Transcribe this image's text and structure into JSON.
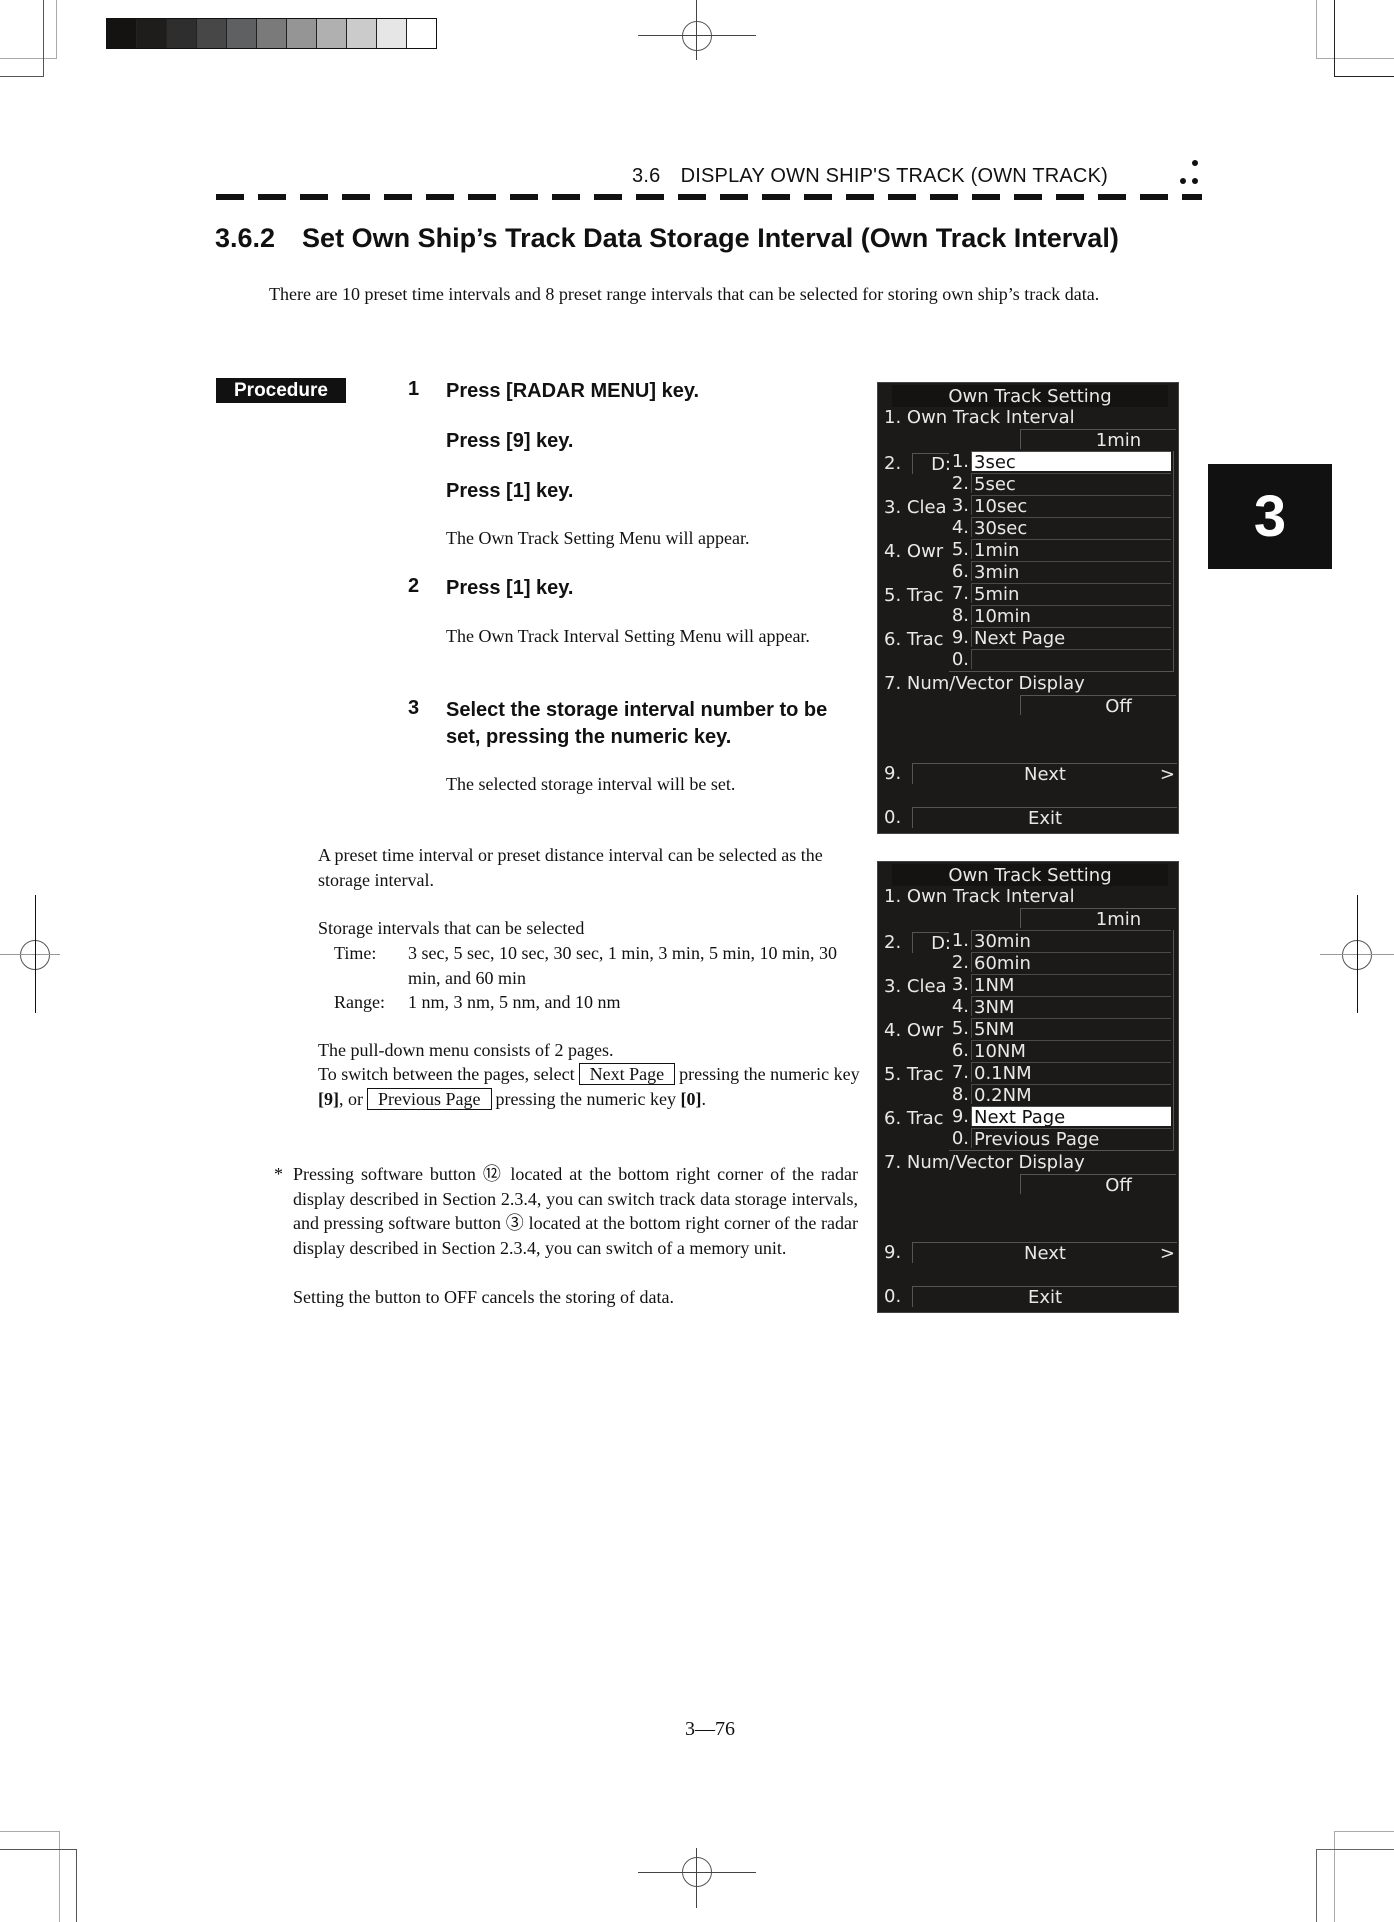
{
  "header": {
    "running_head": "3.6 DISPLAY OWN SHIP'S TRACK (OWN TRACK)",
    "gray_scale": [
      "#141311",
      "#1e1d1b",
      "#2e2e2e",
      "#474747",
      "#5f6061",
      "#7a7a7a",
      "#959595",
      "#b0b0b0",
      "#cbcbcb",
      "#e6e6e6",
      "#ffffff"
    ]
  },
  "section": {
    "title": "3.6.2 Set Own Ship’s Track Data Storage Interval (Own Track Interval)",
    "intro": "There are 10 preset time intervals and 8 preset range intervals that can be selected for storing own ship’s track data."
  },
  "procedure": {
    "badge": "Procedure",
    "steps": [
      {
        "number": "1",
        "lines": [
          "Press [RADAR MENU] key.",
          "Press [9] key.",
          "Press [1] key."
        ],
        "description": "The Own Track Setting Menu will appear."
      },
      {
        "number": "2",
        "lines": [
          "Press [1] key."
        ],
        "description": "The Own Track Interval Setting Menu will appear."
      },
      {
        "number": "3",
        "lines": [
          "Select the storage interval number to be set, pressing the numeric key."
        ],
        "description": "The selected storage interval will be set."
      }
    ]
  },
  "notes": {
    "para1": "A preset time interval or preset distance interval can be selected as the storage interval.",
    "storage_heading": "Storage intervals that can be selected",
    "time_label": "Time:",
    "time_values": "3 sec, 5 sec, 10 sec, 30 sec, 1 min, 3 min, 5 min, 10 min, 30 min, and 60 min",
    "range_label": "Range:",
    "range_values": "1 nm, 3 nm, 5 nm, and 10 nm",
    "pages_line": "The pull-down menu consists of 2 pages.",
    "switch_pre": "To switch between the pages, select",
    "next_page_box": "Next Page",
    "switch_mid1": "pressing the numeric key",
    "key9": "[9]",
    "switch_mid2": ", or",
    "prev_page_box": "Previous Page",
    "switch_mid3": "pressing the numeric key",
    "key0": "[0]",
    "switch_end": ".",
    "asterisk": "*",
    "footnote": "Pressing software button ⑫ located at the bottom right corner of the radar display described in Section 2.3.4, you can switch track data storage intervals, and pressing software button ③ located at the bottom right corner of the radar display described in Section 2.3.4, you can switch of a memory unit.",
    "footnote2": "Setting the button to OFF cancels the storing of data."
  },
  "chapter_tab": "3",
  "page_number": "3—76",
  "menus": [
    {
      "title": "Own Track Setting",
      "item1": "1. Own  Track  Interval",
      "item1_value": "1min",
      "item2": "2.",
      "item2_stub": "D:",
      "item3": "3. Clea",
      "item4": "4. Owr",
      "item5": "5. Trac",
      "item6": "6. Trac",
      "item7": "7. Num/Vector  Display",
      "item7_value": "Off",
      "next_num": "9.",
      "next_label": "Next",
      "next_arrow": ">",
      "exit_num": "0.",
      "exit_label": "Exit",
      "options": [
        {
          "n": "1.",
          "label": "3sec",
          "selected": true
        },
        {
          "n": "2.",
          "label": "5sec"
        },
        {
          "n": "3.",
          "label": "10sec"
        },
        {
          "n": "4.",
          "label": "30sec"
        },
        {
          "n": "5.",
          "label": "1min"
        },
        {
          "n": "6.",
          "label": "3min"
        },
        {
          "n": "7.",
          "label": "5min"
        },
        {
          "n": "8.",
          "label": "10min"
        },
        {
          "n": "9.",
          "label": "Next  Page"
        },
        {
          "n": "0.",
          "label": ""
        }
      ]
    },
    {
      "title": "Own Track Setting",
      "item1": "1. Own  Track  Interval",
      "item1_value": "1min",
      "item2": "2.",
      "item2_stub": "D:",
      "item3": "3. Clea",
      "item4": "4. Owr",
      "item5": "5. Trac",
      "item6": "6. Trac",
      "item7": "7. Num/Vector  Display",
      "item7_value": "Off",
      "next_num": "9.",
      "next_label": "Next",
      "next_arrow": ">",
      "exit_num": "0.",
      "exit_label": "Exit",
      "options": [
        {
          "n": "1.",
          "label": "30min"
        },
        {
          "n": "2.",
          "label": "60min"
        },
        {
          "n": "3.",
          "label": "1NM"
        },
        {
          "n": "4.",
          "label": "3NM"
        },
        {
          "n": "5.",
          "label": "5NM"
        },
        {
          "n": "6.",
          "label": "10NM"
        },
        {
          "n": "7.",
          "label": "0.1NM"
        },
        {
          "n": "8.",
          "label": "0.2NM"
        },
        {
          "n": "9.",
          "label": "Next  Page",
          "selected": true
        },
        {
          "n": "0.",
          "label": "Previous  Page"
        }
      ]
    }
  ]
}
